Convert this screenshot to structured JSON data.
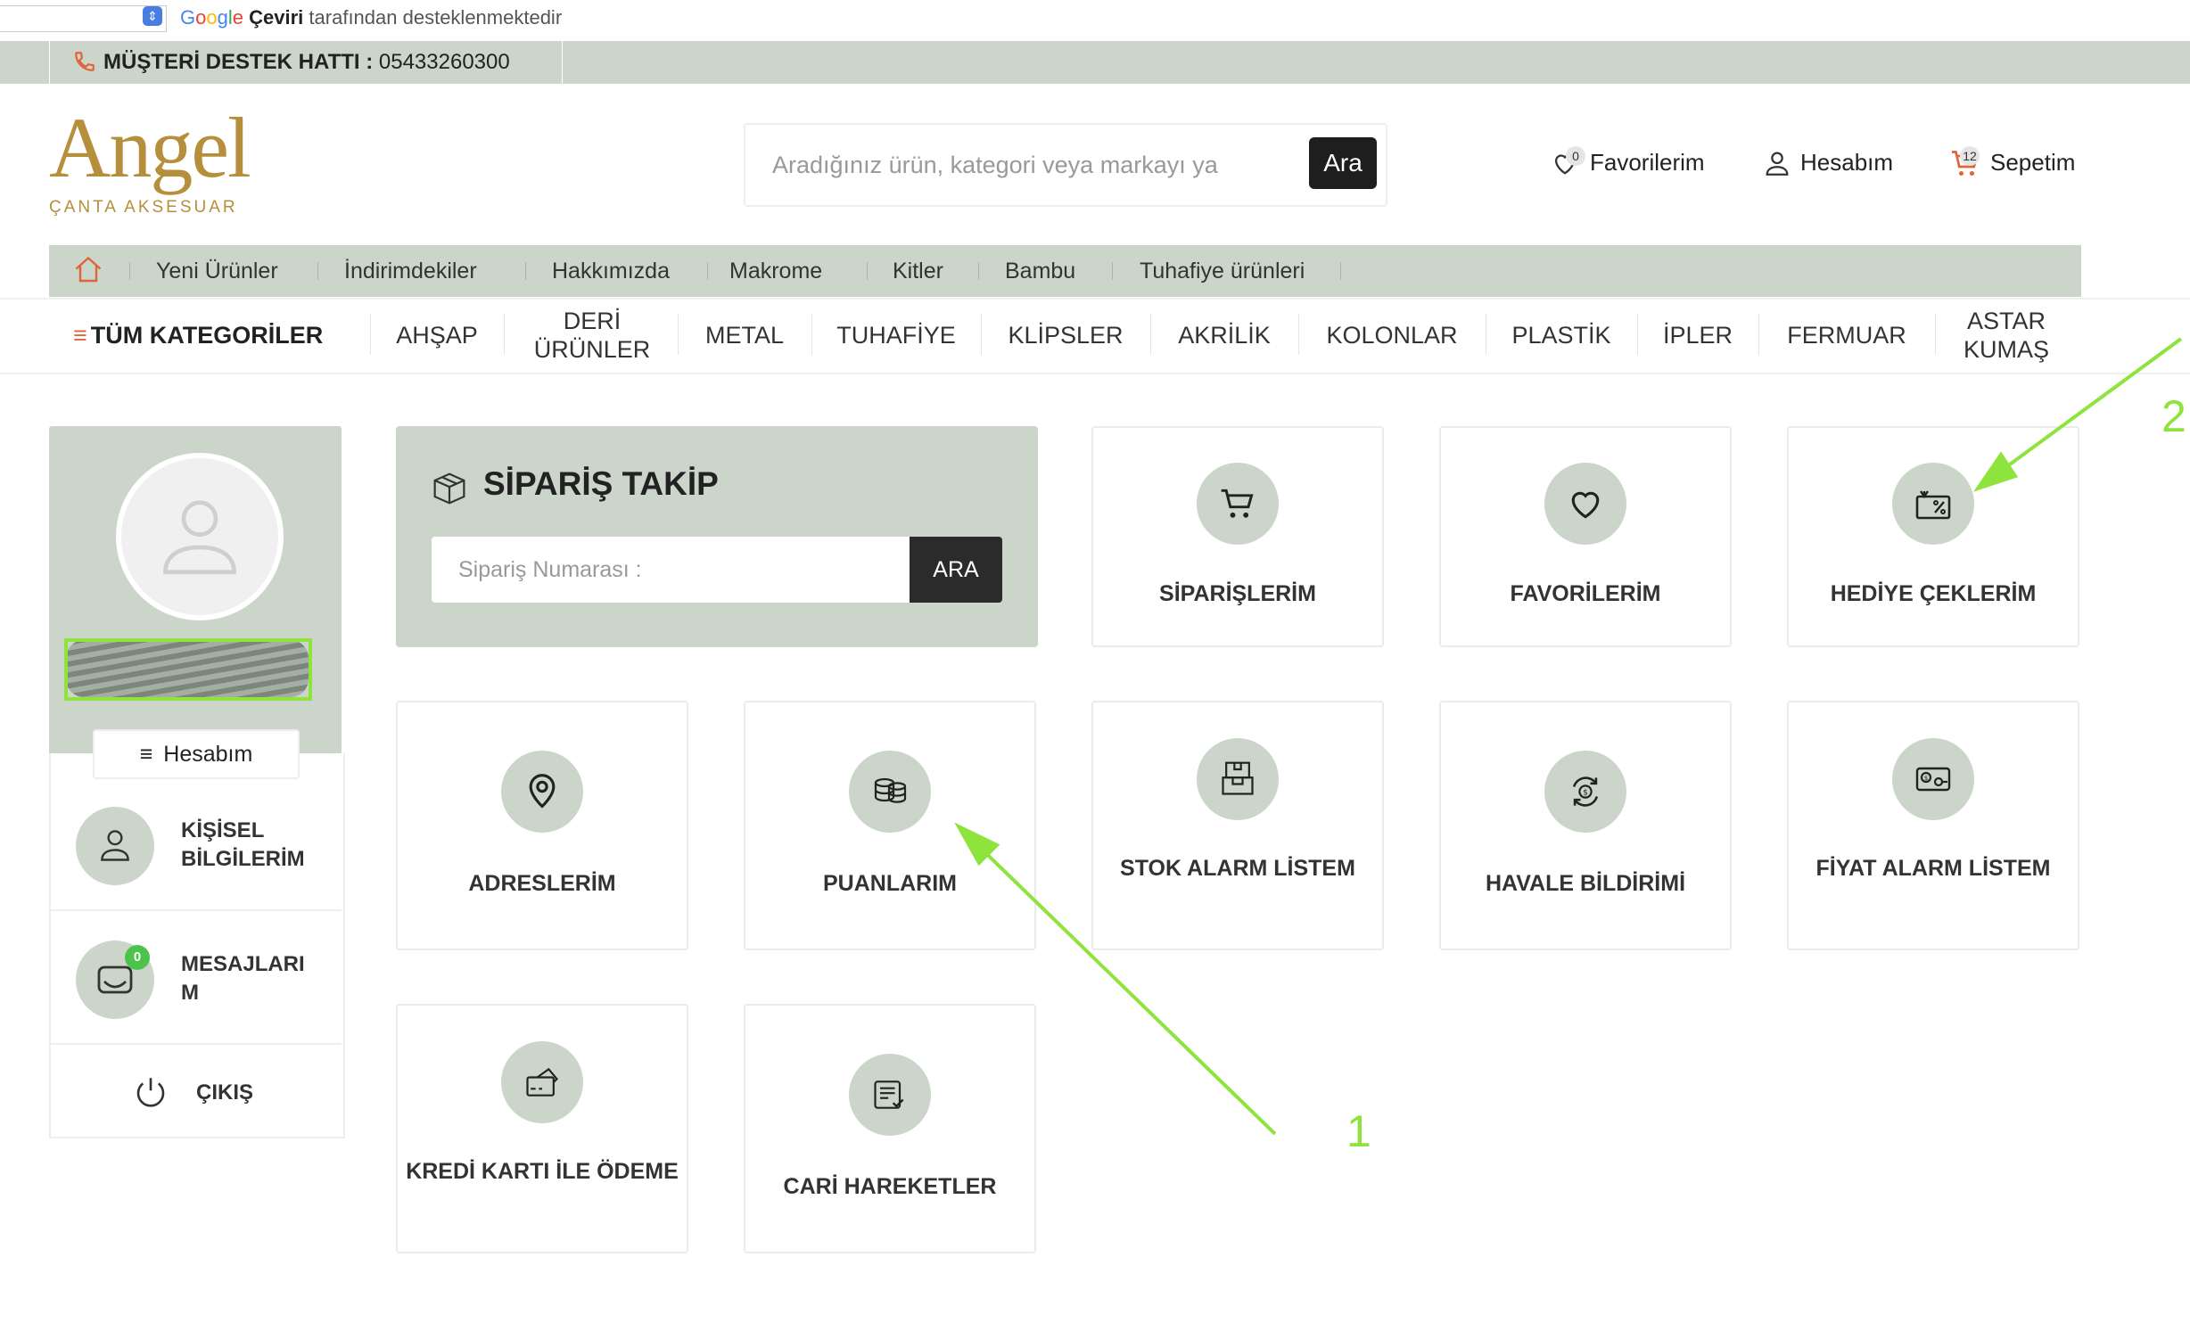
{
  "translate_bar": {
    "google": "Google",
    "ceviri": "Çeviri",
    "suffix": "tarafından desteklenmektedir"
  },
  "support": {
    "label": "MÜŞTERİ DESTEK HATTI :",
    "phone": "05433260300"
  },
  "logo": {
    "name": "Angel",
    "tagline": "ÇANTA AKSESUAR"
  },
  "search": {
    "placeholder": "Aradığınız ürün, kategori veya markayı ya",
    "button": "Ara"
  },
  "header_links": {
    "favorites": "Favorilerim",
    "favorites_count": "0",
    "account": "Hesabım",
    "cart": "Sepetim",
    "cart_count": "12"
  },
  "menu": [
    "Yeni Ürünler",
    "İndirimdekiler",
    "Hakkımızda",
    "Makrome",
    "Kitler",
    "Bambu",
    "Tuhafiye ürünleri"
  ],
  "categories": {
    "all": "TÜM KATEGORİLER",
    "items": [
      "AHŞAP",
      "DERİ ÜRÜNLER",
      "METAL",
      "TUHAFİYE",
      "KLİPSLER",
      "AKRİLİK",
      "KOLONLAR",
      "PLASTİK",
      "İPLER",
      "FERMUAR",
      "ASTAR KUMAŞ"
    ]
  },
  "profile": {
    "account_button": "Hesabım",
    "personal_info": "KİŞİSEL BİLGİLERİM",
    "messages": "MESAJLARIM",
    "messages_count": "0",
    "logout": "ÇIKIŞ"
  },
  "order_tracking": {
    "title": "SİPARİŞ TAKİP",
    "placeholder": "Sipariş Numarası :",
    "button": "ARA"
  },
  "cards": {
    "orders": "SİPARİŞLERİM",
    "favorites": "FAVORİLERİM",
    "gift_cards": "HEDİYE ÇEKLERİM",
    "addresses": "ADRESLERİM",
    "points": "PUANLARIM",
    "stock_alarm": "STOK ALARM LİSTEM",
    "transfer": "HAVALE BİLDİRİMİ",
    "price_alarm": "FİYAT ALARM LİSTEM",
    "credit_card": "KREDİ KARTI İLE ÖDEME",
    "transactions": "CARİ HAREKETLER"
  },
  "annotations": {
    "a1": "1",
    "a2": "2"
  },
  "colors": {
    "sage": "#cbd5ca",
    "gold": "#b58f3b",
    "dark": "#1e1e1e",
    "annotation": "#8ee33c"
  }
}
